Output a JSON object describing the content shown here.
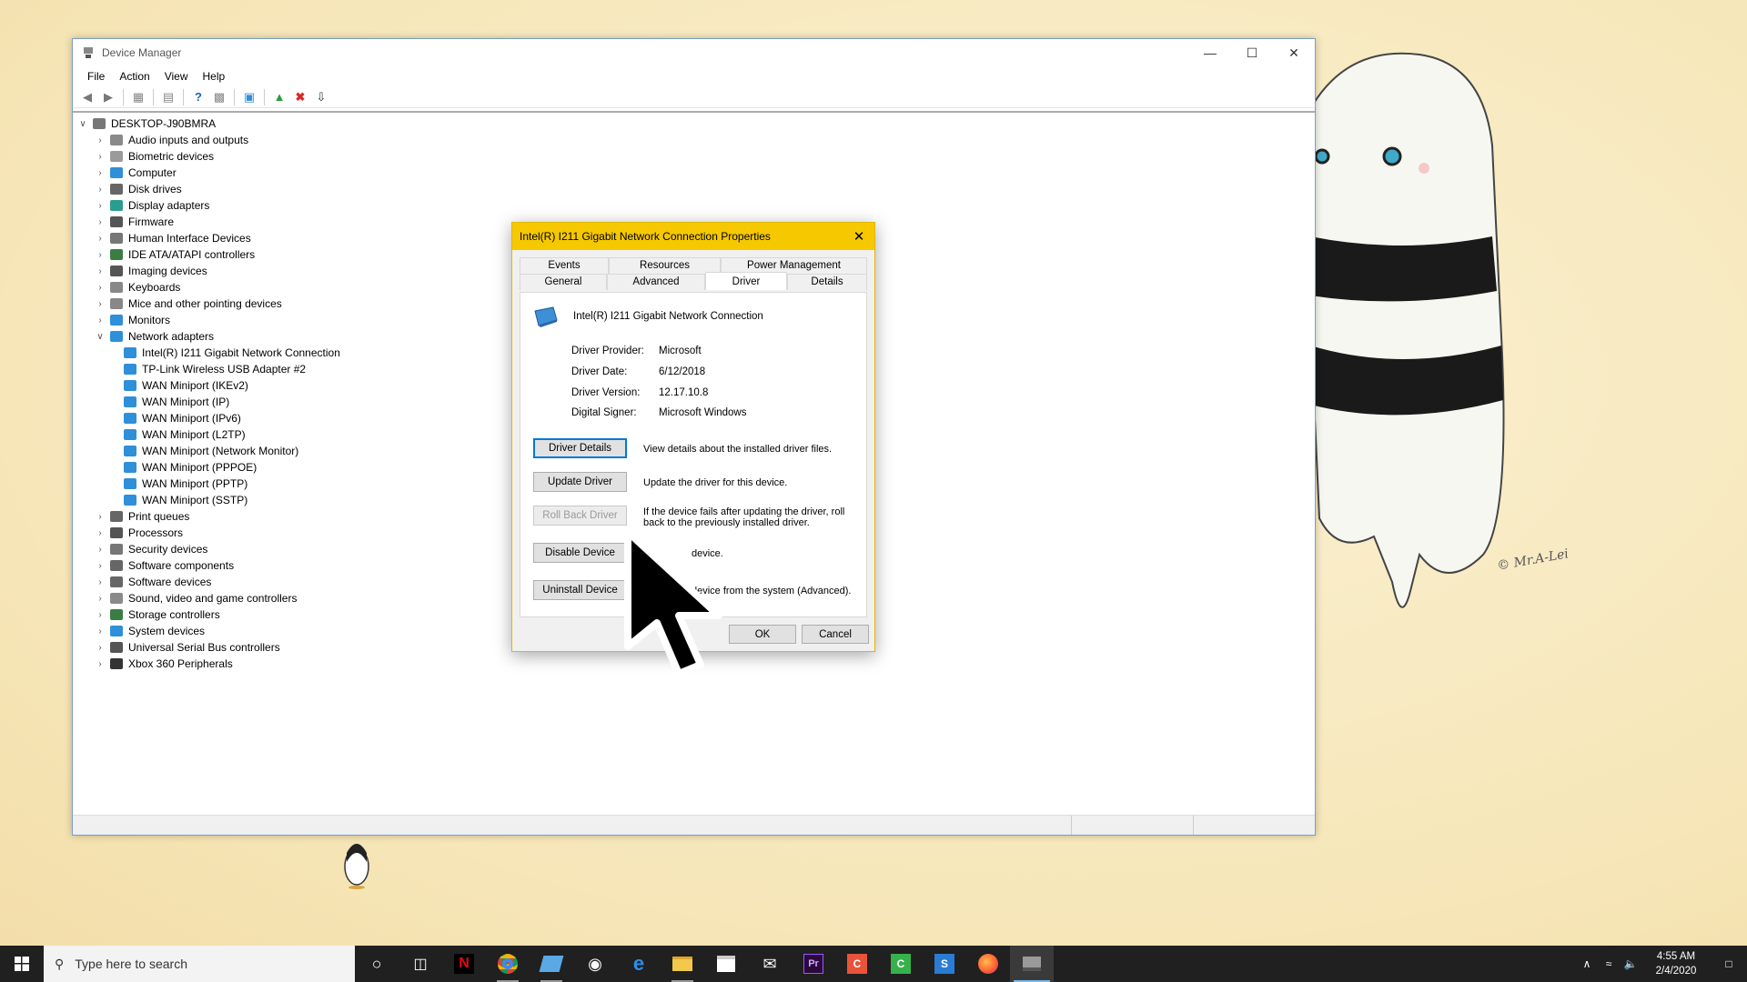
{
  "device_manager": {
    "title": "Device Manager",
    "menu": [
      "File",
      "Action",
      "View",
      "Help"
    ],
    "tree": {
      "root": "DESKTOP-J90BMRA",
      "categories": [
        {
          "label": "Audio inputs and outputs",
          "color": "#8a8a8a"
        },
        {
          "label": "Biometric devices",
          "color": "#9a9a9a"
        },
        {
          "label": "Computer",
          "color": "#2f8fd8"
        },
        {
          "label": "Disk drives",
          "color": "#666666"
        },
        {
          "label": "Display adapters",
          "color": "#2a9d8f"
        },
        {
          "label": "Firmware",
          "color": "#555555"
        },
        {
          "label": "Human Interface Devices",
          "color": "#777777"
        },
        {
          "label": "IDE ATA/ATAPI controllers",
          "color": "#3a7d44"
        },
        {
          "label": "Imaging devices",
          "color": "#555555"
        },
        {
          "label": "Keyboards",
          "color": "#888888"
        },
        {
          "label": "Mice and other pointing devices",
          "color": "#888888"
        },
        {
          "label": "Monitors",
          "color": "#2f8fd8"
        }
      ],
      "network_adapters": {
        "label": "Network adapters",
        "children": [
          "Intel(R) I211 Gigabit Network Connection",
          "TP-Link Wireless USB Adapter #2",
          "WAN Miniport (IKEv2)",
          "WAN Miniport (IP)",
          "WAN Miniport (IPv6)",
          "WAN Miniport (L2TP)",
          "WAN Miniport (Network Monitor)",
          "WAN Miniport (PPPOE)",
          "WAN Miniport (PPTP)",
          "WAN Miniport (SSTP)"
        ]
      },
      "categories_after": [
        {
          "label": "Print queues",
          "color": "#666666"
        },
        {
          "label": "Processors",
          "color": "#555555"
        },
        {
          "label": "Security devices",
          "color": "#777777"
        },
        {
          "label": "Software components",
          "color": "#666666"
        },
        {
          "label": "Software devices",
          "color": "#666666"
        },
        {
          "label": "Sound, video and game controllers",
          "color": "#8a8a8a"
        },
        {
          "label": "Storage controllers",
          "color": "#3a7d44"
        },
        {
          "label": "System devices",
          "color": "#2f8fd8"
        },
        {
          "label": "Universal Serial Bus controllers",
          "color": "#555555"
        },
        {
          "label": "Xbox 360 Peripherals",
          "color": "#333333"
        }
      ]
    }
  },
  "dialog": {
    "title": "Intel(R) I211 Gigabit Network Connection Properties",
    "tabs_back": [
      "Events",
      "Resources",
      "Power Management"
    ],
    "tabs_front": [
      "General",
      "Advanced",
      "Driver",
      "Details"
    ],
    "active_tab": "Driver",
    "device_name": "Intel(R) I211 Gigabit Network Connection",
    "info": [
      {
        "label": "Driver Provider:",
        "value": "Microsoft"
      },
      {
        "label": "Driver Date:",
        "value": "6/12/2018"
      },
      {
        "label": "Driver Version:",
        "value": "12.17.10.8"
      },
      {
        "label": "Digital Signer:",
        "value": "Microsoft Windows"
      }
    ],
    "buttons": [
      {
        "label": "Driver Details",
        "desc": "View details about the installed driver files."
      },
      {
        "label": "Update Driver",
        "desc": "Update the driver for this device."
      },
      {
        "label": "Roll Back Driver",
        "desc": "If the device fails after updating the driver, roll back to the previously installed driver."
      },
      {
        "label": "Disable Device",
        "desc": "device."
      },
      {
        "label": "Uninstall Device",
        "desc": "device from the system (Advanced)."
      }
    ],
    "ok": "OK",
    "cancel": "Cancel"
  },
  "wallpaper": {
    "signature": "© Mr.A-Lei"
  },
  "taskbar": {
    "search_placeholder": "Type here to search",
    "time": "4:55 AM",
    "date": "2/4/2020"
  }
}
